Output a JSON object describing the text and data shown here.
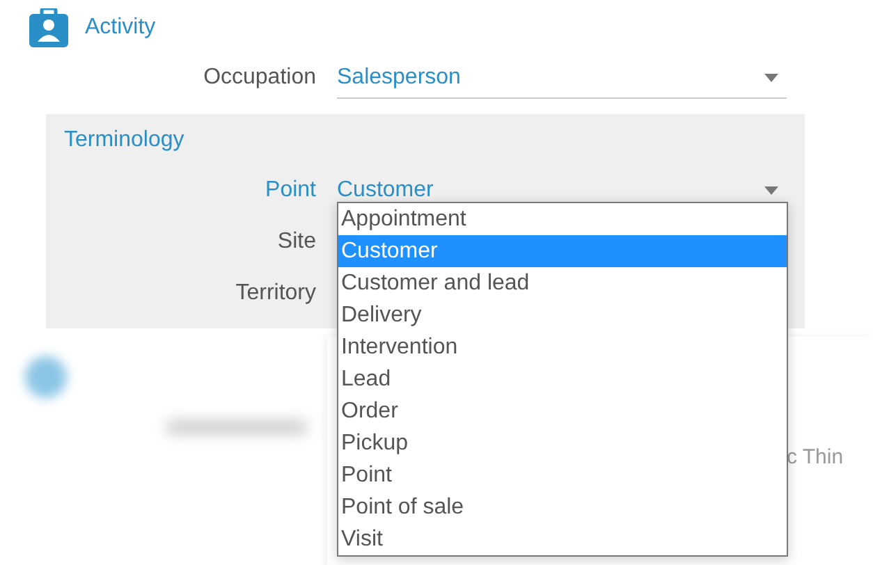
{
  "section": {
    "title": "Activity"
  },
  "occupation": {
    "label": "Occupation",
    "value": "Salesperson"
  },
  "terminology": {
    "title": "Terminology",
    "fields": [
      {
        "label": "Point",
        "value": "Customer"
      },
      {
        "label": "Site"
      },
      {
        "label": "Territory"
      }
    ]
  },
  "dropdown": {
    "options": [
      {
        "label": "Appointment",
        "selected": false
      },
      {
        "label": "Customer",
        "selected": true
      },
      {
        "label": "Customer and lead",
        "selected": false
      },
      {
        "label": "Delivery",
        "selected": false
      },
      {
        "label": "Intervention",
        "selected": false
      },
      {
        "label": "Lead",
        "selected": false
      },
      {
        "label": "Order",
        "selected": false
      },
      {
        "label": "Pickup",
        "selected": false
      },
      {
        "label": "Point",
        "selected": false
      },
      {
        "label": "Point of sale",
        "selected": false
      },
      {
        "label": "Visit",
        "selected": false
      }
    ]
  },
  "background_text": "c Thin"
}
